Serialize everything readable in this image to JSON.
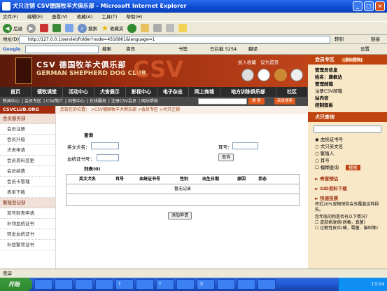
{
  "window": {
    "title": "犬只注销 CSV德国牧羊犬俱乐部 - Microsoft Internet Explorer",
    "min": "_",
    "max": "□",
    "close": "×"
  },
  "menu": [
    "文件(F)",
    "编辑(E)",
    "查看(V)",
    "收藏(A)",
    "工具(T)",
    "帮助(H)"
  ],
  "toolbar": {
    "back": "后退",
    "search": "搜索",
    "favorites": "收藏夹"
  },
  "address": {
    "label": "地址(D)",
    "url": "http://127.0.0.1/servlet/Folder?node=4516961&language=1",
    "go": "转到",
    "links": "链接"
  },
  "google": {
    "label": "Google",
    "search": "搜索",
    "news": "资讯",
    "bookmarks": "书签",
    "blocked": "已拦截 5254",
    "translate": "翻译",
    "settings": "设置"
  },
  "site": {
    "cn_title": "CSV 德国牧羊犬俱乐部",
    "en_title": "GERMAN SHEPHERD DOG CLUB",
    "watermark": "CSV",
    "join": "加入收藏",
    "home": "设为首页",
    "mainnav": [
      "首页",
      "德牧课堂",
      "活动中心",
      "犬舍展示",
      "影视中心",
      "电子杂志",
      "网上商城",
      "地方训练俱乐部",
      "社区"
    ],
    "subnav": [
      "新闻中心",
      "会员专区",
      "CSV简介",
      "问答中心",
      "在线服务",
      "注册CSV会员",
      "网站帮助"
    ],
    "search_btn": "搜 索",
    "adv_search_btn": "高级搜索"
  },
  "sidebar": {
    "logo": "CSVCLUB.ORG",
    "head": "会员服务部",
    "items": [
      "会员注册",
      "会员升级",
      "犬舍申请",
      "会员资料变更",
      "会员续费",
      "会员卡管理",
      "表单下载"
    ],
    "section2": "繁殖登记部",
    "items2": [
      "耳号刺青申请",
      "补领血统证书",
      "转发血统证书",
      "补登繁育证书"
    ]
  },
  "main": {
    "location": "您现在的位置：  >CSV德国牧羊犬俱乐部   >会员专区   >犬只注销",
    "query_title": "查询",
    "label_name": "英文犬名：",
    "label_ear": "耳号：",
    "label_cert": "血统证书号：",
    "query_btn": "查询",
    "list_title": "列表(0)",
    "columns": [
      "英文犬名",
      "耳号",
      "血统证书号",
      "性别",
      "出生日期",
      "原因",
      "状态"
    ],
    "empty": "暂无记录",
    "add_btn": "添加申请"
  },
  "right": {
    "member_head": "会员专区",
    "logout": "[退出登陆]",
    "member_items": [
      "管理员信息",
      "姓名：",
      "管理邮箱",
      "注册CSV邮箱",
      "站内信",
      "控制面板"
    ],
    "name_value": "唐枫达",
    "dog_head": "犬只查询",
    "options": [
      "血统证书号",
      "犬只英文名",
      "繁殖人",
      "耳号",
      "模糊查询"
    ],
    "search_btn": "搜索",
    "notice": "寄害预估",
    "sid": "SID资料下载",
    "vote_head": "快速投票",
    "vote_text": "将近20%宠物保险会去覆盖这样损失。",
    "vote_q": "您年底的狗是否有以下情况？",
    "vote_opts": [
      "皮肤病发病(病毒，真菌)",
      "过敏性皮炎(螨，霉菌、猫科等)"
    ]
  },
  "status": "完毕",
  "taskbar": {
    "start": "开始",
    "tasks": [
      "",
      "",
      "",
      "",
      "T",
      "",
      "T",
      "",
      "大",
      "",
      "",
      "",
      ""
    ],
    "clock": "13:24"
  }
}
